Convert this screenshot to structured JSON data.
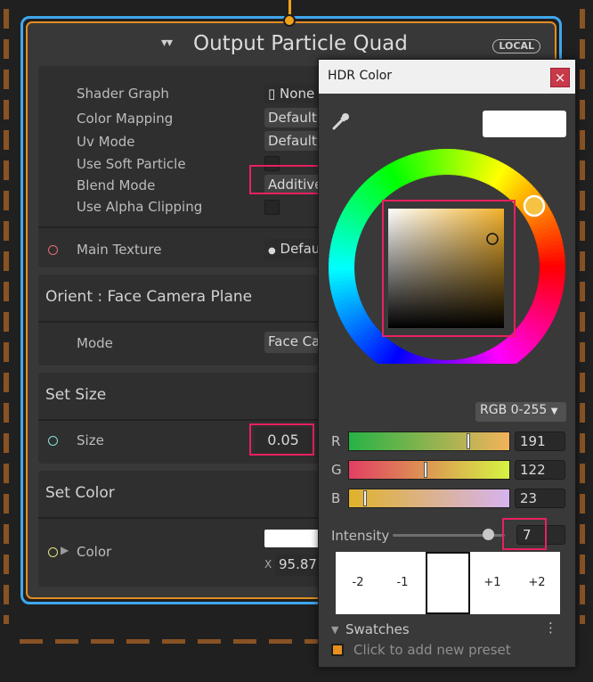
{
  "node": {
    "icon": "vfx-output-icon",
    "title": "Output Particle Quad",
    "badge": "LOCAL"
  },
  "output_block": {
    "rows": [
      {
        "label": "Shader Graph",
        "value": "None"
      },
      {
        "label": "Color Mapping",
        "value": "Default"
      },
      {
        "label": "Uv Mode",
        "value": "Default"
      },
      {
        "label": "Use Soft Particle",
        "value": ""
      },
      {
        "label": "Blend Mode",
        "value": "Additive"
      },
      {
        "label": "Use Alpha Clipping",
        "value": ""
      }
    ],
    "main_texture_label": "Main Texture",
    "main_texture_value": "Default"
  },
  "orient_block": {
    "title": "Orient : Face Camera Plane",
    "mode_label": "Mode",
    "mode_value": "Face Camera Plane"
  },
  "size_block": {
    "title": "Set Size",
    "size_label": "Size",
    "size_value": "0.05"
  },
  "color_block": {
    "title": "Set Color",
    "color_label": "Color",
    "x_label": "X",
    "x_value": "95.87"
  },
  "picker": {
    "title": "HDR Color",
    "close_label": "×",
    "swatch_color": "#ffffff",
    "mode": "RGB 0-255",
    "channels": [
      {
        "label": "R",
        "value": "191",
        "fraction": 0.749
      },
      {
        "label": "G",
        "value": "122",
        "fraction": 0.478
      },
      {
        "label": "B",
        "value": "23",
        "fraction": 0.09
      }
    ],
    "intensity_label": "Intensity",
    "intensity_value": "7",
    "exposure": [
      "-2",
      "-1",
      "+1",
      "+2"
    ],
    "swatches_label": "Swatches",
    "swatches_menu": "⋮",
    "preset_label": "Click to add new preset"
  },
  "colors": {
    "accent_blue": "#3fa7ee",
    "accent_orange": "#e38d22",
    "highlight": "#e8215f"
  }
}
